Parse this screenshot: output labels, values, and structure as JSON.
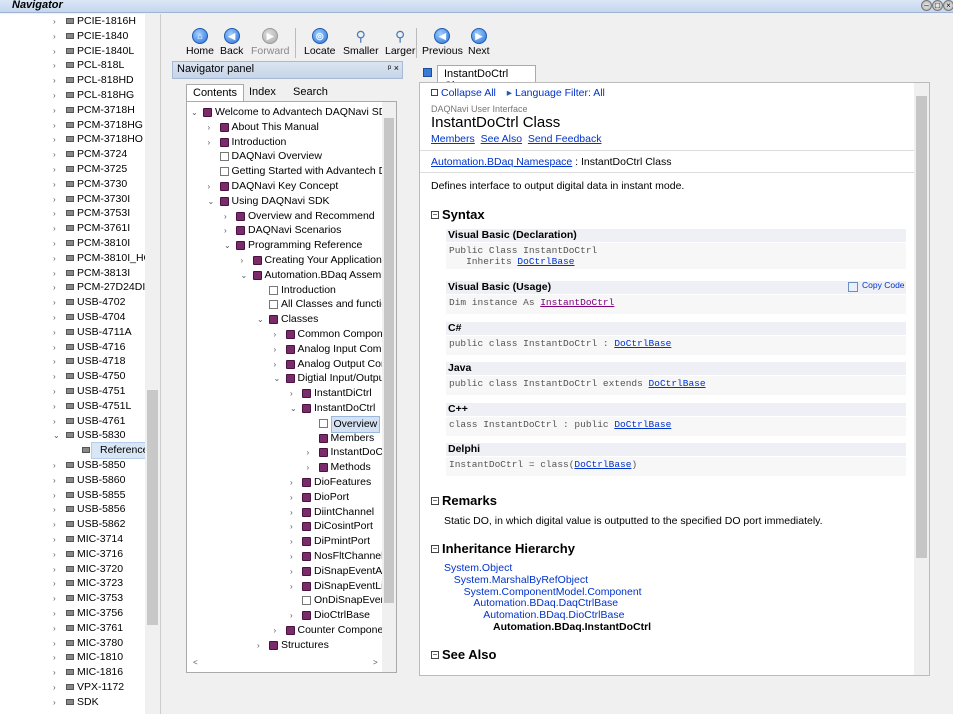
{
  "window": {
    "title": "Navigator"
  },
  "left_tree": {
    "items": [
      {
        "label": "PCIE-1816H"
      },
      {
        "label": "PCIE-1840"
      },
      {
        "label": "PCIE-1840L"
      },
      {
        "label": "PCL-818L"
      },
      {
        "label": "PCL-818HD"
      },
      {
        "label": "PCL-818HG"
      },
      {
        "label": "PCM-3718H"
      },
      {
        "label": "PCM-3718HG"
      },
      {
        "label": "PCM-3718HO"
      },
      {
        "label": "PCM-3724"
      },
      {
        "label": "PCM-3725"
      },
      {
        "label": "PCM-3730"
      },
      {
        "label": "PCM-3730I"
      },
      {
        "label": "PCM-3753I"
      },
      {
        "label": "PCM-3761I"
      },
      {
        "label": "PCM-3810I"
      },
      {
        "label": "PCM-3810I_HG"
      },
      {
        "label": "PCM-3813I"
      },
      {
        "label": "PCM-27D24DI"
      },
      {
        "label": "USB-4702"
      },
      {
        "label": "USB-4704"
      },
      {
        "label": "USB-4711A"
      },
      {
        "label": "USB-4716"
      },
      {
        "label": "USB-4718"
      },
      {
        "label": "USB-4750"
      },
      {
        "label": "USB-4751"
      },
      {
        "label": "USB-4751L"
      },
      {
        "label": "USB-4761"
      },
      {
        "label": "USB-5830"
      },
      {
        "label": "Reference"
      },
      {
        "label": "USB-5850"
      },
      {
        "label": "USB-5860"
      },
      {
        "label": "USB-5855"
      },
      {
        "label": "USB-5856"
      },
      {
        "label": "USB-5862"
      },
      {
        "label": "MIC-3714"
      },
      {
        "label": "MIC-3716"
      },
      {
        "label": "MIC-3720"
      },
      {
        "label": "MIC-3723"
      },
      {
        "label": "MIC-3753"
      },
      {
        "label": "MIC-3756"
      },
      {
        "label": "MIC-3761"
      },
      {
        "label": "MIC-3780"
      },
      {
        "label": "MIC-1810"
      },
      {
        "label": "MIC-1816"
      },
      {
        "label": "VPX-1172"
      },
      {
        "label": "SDK"
      }
    ]
  },
  "toolbar": {
    "home": "Home",
    "back": "Back",
    "forward": "Forward",
    "locate": "Locate",
    "smaller": "Smaller",
    "larger": "Larger",
    "previous": "Previous",
    "next": "Next"
  },
  "nav_panel": {
    "title": "Navigator panel",
    "pin": "ᵖ ×",
    "tabs": [
      "Contents",
      "Index",
      "Search"
    ]
  },
  "contents_tree": {
    "items": [
      {
        "label": "Welcome to Advantech DAQNavi SDK"
      },
      {
        "label": "About This Manual"
      },
      {
        "label": "Introduction"
      },
      {
        "label": "DAQNavi Overview"
      },
      {
        "label": "Getting Started with Advantech DA"
      },
      {
        "label": "DAQNavi Key Concept"
      },
      {
        "label": "Using DAQNavi SDK"
      },
      {
        "label": "Overview and Recommend"
      },
      {
        "label": "DAQNavi Scenarios"
      },
      {
        "label": "Programming Reference"
      },
      {
        "label": "Creating Your Application a"
      },
      {
        "label": "Automation.BDaq Assembly"
      },
      {
        "label": "Introduction"
      },
      {
        "label": "All Classes and function"
      },
      {
        "label": "Classes"
      },
      {
        "label": "Common Componen"
      },
      {
        "label": "Analog Input Comp"
      },
      {
        "label": "Analog Output Com"
      },
      {
        "label": "Digtial Input/Output"
      },
      {
        "label": "InstantDiCtrl"
      },
      {
        "label": "InstantDoCtrl"
      },
      {
        "label": "Overview"
      },
      {
        "label": "Members"
      },
      {
        "label": "InstantDoCt"
      },
      {
        "label": "Methods"
      },
      {
        "label": "DioFeatures"
      },
      {
        "label": "DioPort"
      },
      {
        "label": "DiintChannel"
      },
      {
        "label": "DiCosintPort"
      },
      {
        "label": "DiPmintPort"
      },
      {
        "label": "NosFltChannel"
      },
      {
        "label": "DiSnapEventArg"
      },
      {
        "label": "DiSnapEventList"
      },
      {
        "label": "OnDiSnapEvent"
      },
      {
        "label": "DioCtrlBase"
      },
      {
        "label": "Counter Componen"
      },
      {
        "label": "Structures"
      }
    ]
  },
  "doc": {
    "tab": "InstantDoCtrl Class",
    "collapse_all": "Collapse All",
    "language_filter": "Language Filter: All",
    "subtitle": "DAQNavi User Interface",
    "title": "InstantDoCtrl Class",
    "links": {
      "members": "Members",
      "see_also": "See Also",
      "feedback": "Send Feedback"
    },
    "namespace_link": "Automation.BDaq Namespace",
    "namespace_rest": " : InstantDoCtrl Class",
    "description": "Defines interface to output digital data in instant mode.",
    "syntax_heading": "Syntax",
    "copy_code": "Copy Code",
    "syntax": [
      {
        "lang": "Visual Basic (Declaration)",
        "line1": "Public Class InstantDoCtrl",
        "line2_pre": "   Inherits ",
        "line2_link": "DoCtrlBase",
        "line2_post": ""
      },
      {
        "lang": "Visual Basic (Usage)",
        "line1": "",
        "line2_pre": "Dim instance As ",
        "line2_link": "InstantDoCtrl",
        "line2_post": ""
      },
      {
        "lang": "C#",
        "line1": "",
        "line2_pre": "public class InstantDoCtrl : ",
        "line2_link": "DoCtrlBase",
        "line2_post": ""
      },
      {
        "lang": "Java",
        "line1": "",
        "line2_pre": "public class InstantDoCtrl extends ",
        "line2_link": "DoCtrlBase",
        "line2_post": ""
      },
      {
        "lang": "C++",
        "line1": "",
        "line2_pre": "class InstantDoCtrl : public ",
        "line2_link": "DoCtrlBase",
        "line2_post": ""
      },
      {
        "lang": "Delphi",
        "line1": "",
        "line2_pre": "InstantDoCtrl = class(",
        "line2_link": "DoCtrlBase",
        "line2_post": ")"
      }
    ],
    "remarks_heading": "Remarks",
    "remarks": "Static DO, in which digital value is outputted to the specified DO port immediately.",
    "inheritance_heading": "Inheritance Hierarchy",
    "inheritance": [
      "System.Object",
      "System.MarshalByRefObject",
      "System.ComponentModel.Component",
      "Automation.BDaq.DaqCtrlBase",
      "Automation.BDaq.DioCtrlBase",
      "Automation.BDaq.InstantDoCtrl"
    ],
    "see_also_heading": "See Also"
  }
}
